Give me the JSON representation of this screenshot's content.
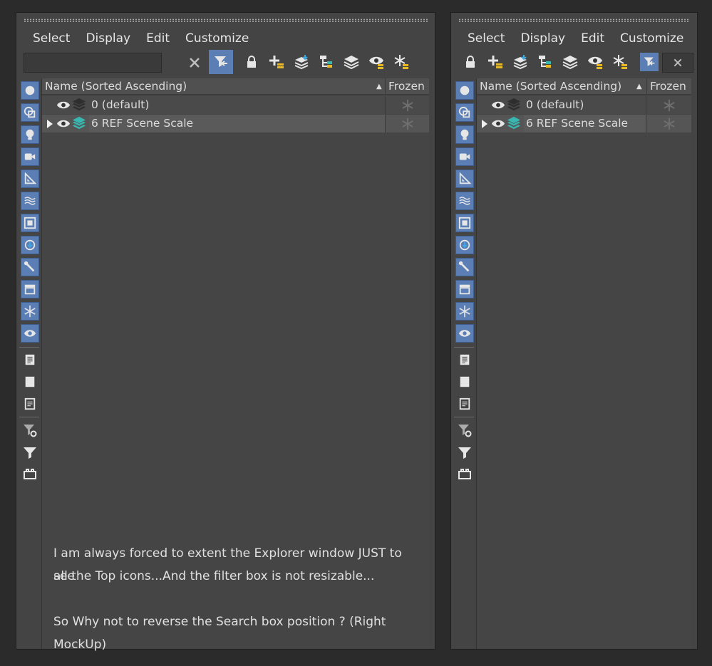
{
  "menu": [
    "Select",
    "Display",
    "Edit",
    "Customize"
  ],
  "columns": {
    "name": "Name (Sorted Ascending)",
    "sort_indicator": "▲",
    "frozen": "Frozen"
  },
  "layers": [
    {
      "label": "0 (default)"
    },
    {
      "label": "6 REF Scene Scale"
    }
  ],
  "toolbar_icons": [
    "lock-icon",
    "add-layer-icon",
    "add-to-layer-icon",
    "hierarchy-icon",
    "layers-icon",
    "hide-icon",
    "freeze-icon"
  ],
  "note": {
    "line1": "I am always forced to extent the Explorer window JUST to see",
    "line2": "all the Top icons...And the filter box is not resizable...",
    "line3": "So Why not to reverse the Search box position ? (Right MockUp)"
  },
  "colors": {
    "accent": "#5b7fb5",
    "layer_teal": "#38b6b0",
    "layer_yellow": "#e8b923"
  }
}
